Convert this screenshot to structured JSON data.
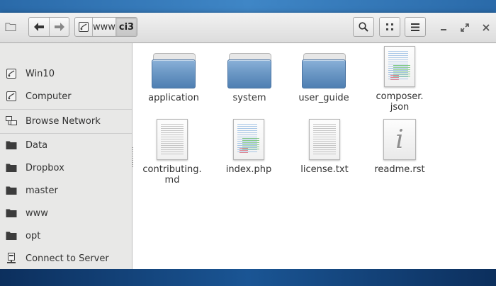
{
  "breadcrumbs": [
    {
      "label": "",
      "icon": "drive-icon"
    },
    {
      "label": "www"
    },
    {
      "label": "ci3",
      "active": true
    }
  ],
  "sidebar": {
    "items": [
      {
        "label": "Win10",
        "icon": "drive-icon"
      },
      {
        "label": "Computer",
        "icon": "drive-icon"
      },
      {
        "label": "Browse Network",
        "icon": "network-icon"
      },
      {
        "label": "Data",
        "icon": "folder-icon"
      },
      {
        "label": "Dropbox",
        "icon": "folder-icon"
      },
      {
        "label": "master",
        "icon": "folder-icon"
      },
      {
        "label": "www",
        "icon": "folder-icon"
      },
      {
        "label": "opt",
        "icon": "folder-icon"
      },
      {
        "label": "Connect to Server",
        "icon": "server-icon"
      }
    ]
  },
  "files": [
    {
      "name": "application",
      "type": "folder"
    },
    {
      "name": "system",
      "type": "folder"
    },
    {
      "name": "user_guide",
      "type": "folder"
    },
    {
      "name": "composer.\njson",
      "type": "code"
    },
    {
      "name": "contributing.\nmd",
      "type": "text"
    },
    {
      "name": "index.php",
      "type": "code"
    },
    {
      "name": "license.txt",
      "type": "text"
    },
    {
      "name": "readme.rst",
      "type": "info"
    }
  ],
  "colors": {
    "accent": "#6c98c5",
    "desktop": "#1b4a82"
  }
}
